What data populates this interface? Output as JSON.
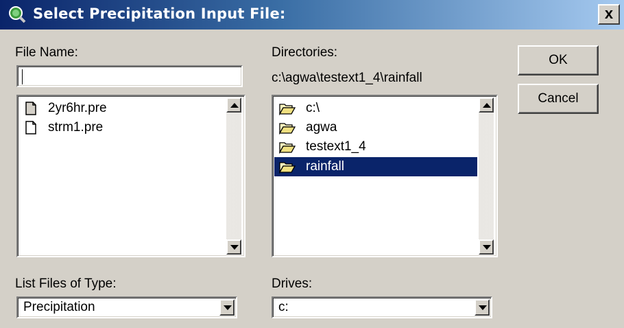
{
  "window": {
    "title": "Select Precipitation Input File:",
    "close_glyph": "x"
  },
  "file_name": {
    "label": "File Name:",
    "value": ""
  },
  "files": {
    "items": [
      "2yr6hr.pre",
      "strm1.pre"
    ]
  },
  "directories": {
    "label": "Directories:",
    "current_path": "c:\\agwa\\testext1_4\\rainfall",
    "items": [
      "c:\\",
      "agwa",
      "testext1_4",
      "rainfall"
    ],
    "selected_index": 3
  },
  "file_type": {
    "label": "List Files of Type:",
    "selected": "Precipitation"
  },
  "drives": {
    "label": "Drives:",
    "selected": "c:"
  },
  "buttons": {
    "ok": "OK",
    "cancel": "Cancel"
  },
  "colors": {
    "selection": "#0a246a",
    "titlebar_start": "#0a246a",
    "titlebar_end": "#a6caf0",
    "face": "#d4d0c8"
  }
}
